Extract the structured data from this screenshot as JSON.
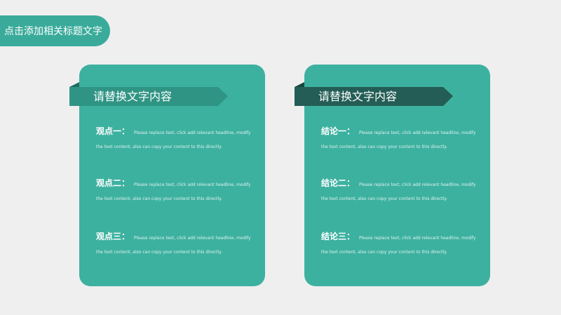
{
  "slide_title": "点击添加相关标题文字",
  "left_card": {
    "heading": "请替换文字内容",
    "items": [
      {
        "label": "观点一：",
        "text": "Please replace text, click add relevant headline, modify the text content, also can copy your content to this directly."
      },
      {
        "label": "观点二：",
        "text": "Please replace text, click add relevant headline, modify the text content, also can copy your content to this directly."
      },
      {
        "label": "观点三：",
        "text": "Please replace text, click add relevant headline, modify the text content, also can copy your content to this directly."
      }
    ]
  },
  "right_card": {
    "heading": "请替换文字内容",
    "items": [
      {
        "label": "结论一：",
        "text": "Please replace text, click add relevant headline, modify the text content, also can copy your content to this directly."
      },
      {
        "label": "结论二：",
        "text": "Please replace text, click add relevant headline, modify the text content, also can copy your content to this directly."
      },
      {
        "label": "结论三：",
        "text": "Please replace text, click add relevant headline, modify the text content, also can copy your content to this directly."
      }
    ]
  },
  "colors": {
    "background": "#efefef",
    "accent": "#3db1a0",
    "ribbon_light": "#2f9484",
    "ribbon_dark": "#235d55"
  }
}
